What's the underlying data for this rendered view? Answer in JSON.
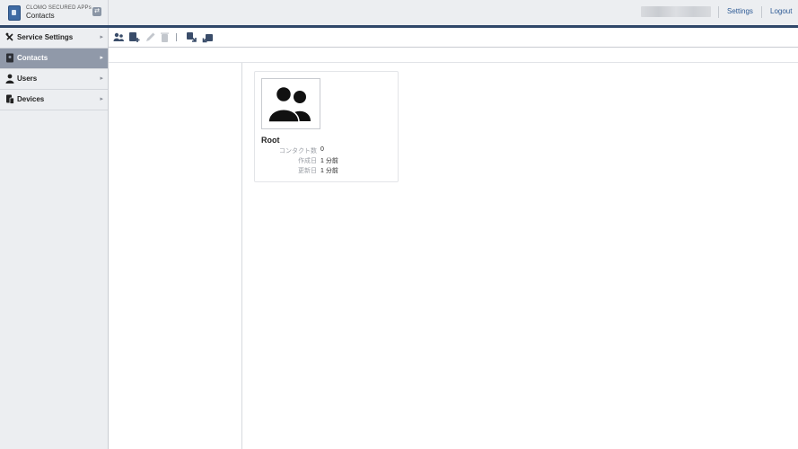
{
  "header": {
    "app_subtitle": "CLOMO SECURED APPs",
    "app_title": "Contacts",
    "links": {
      "settings": "Settings",
      "logout": "Logout"
    }
  },
  "sidebar": {
    "items": [
      {
        "label": "Service Settings",
        "icon": "tools-icon",
        "active": false
      },
      {
        "label": "Contacts",
        "icon": "contacts-book-icon",
        "active": true
      },
      {
        "label": "Users",
        "icon": "user-icon",
        "active": false
      },
      {
        "label": "Devices",
        "icon": "devices-icon",
        "active": false
      }
    ]
  },
  "toolbar": {
    "buttons": [
      {
        "icon": "add-contact-icon",
        "enabled": true
      },
      {
        "icon": "add-group-icon",
        "enabled": true
      },
      {
        "icon": "edit-icon",
        "enabled": false
      },
      {
        "icon": "delete-icon",
        "enabled": false
      },
      {
        "icon": "import-icon",
        "enabled": true
      },
      {
        "icon": "export-icon",
        "enabled": true
      }
    ]
  },
  "group_card": {
    "name": "Root",
    "icon": "group-people-icon",
    "meta": [
      {
        "label": "コンタクト数",
        "value": "0"
      },
      {
        "label": "作成日",
        "value": "1 分前"
      },
      {
        "label": "更新日",
        "value": "1 分前"
      }
    ]
  },
  "colors": {
    "header_rule": "#2f4769",
    "sidebar_bg": "#eceef1",
    "active_item": "#9099a9",
    "link": "#2d5a95"
  }
}
